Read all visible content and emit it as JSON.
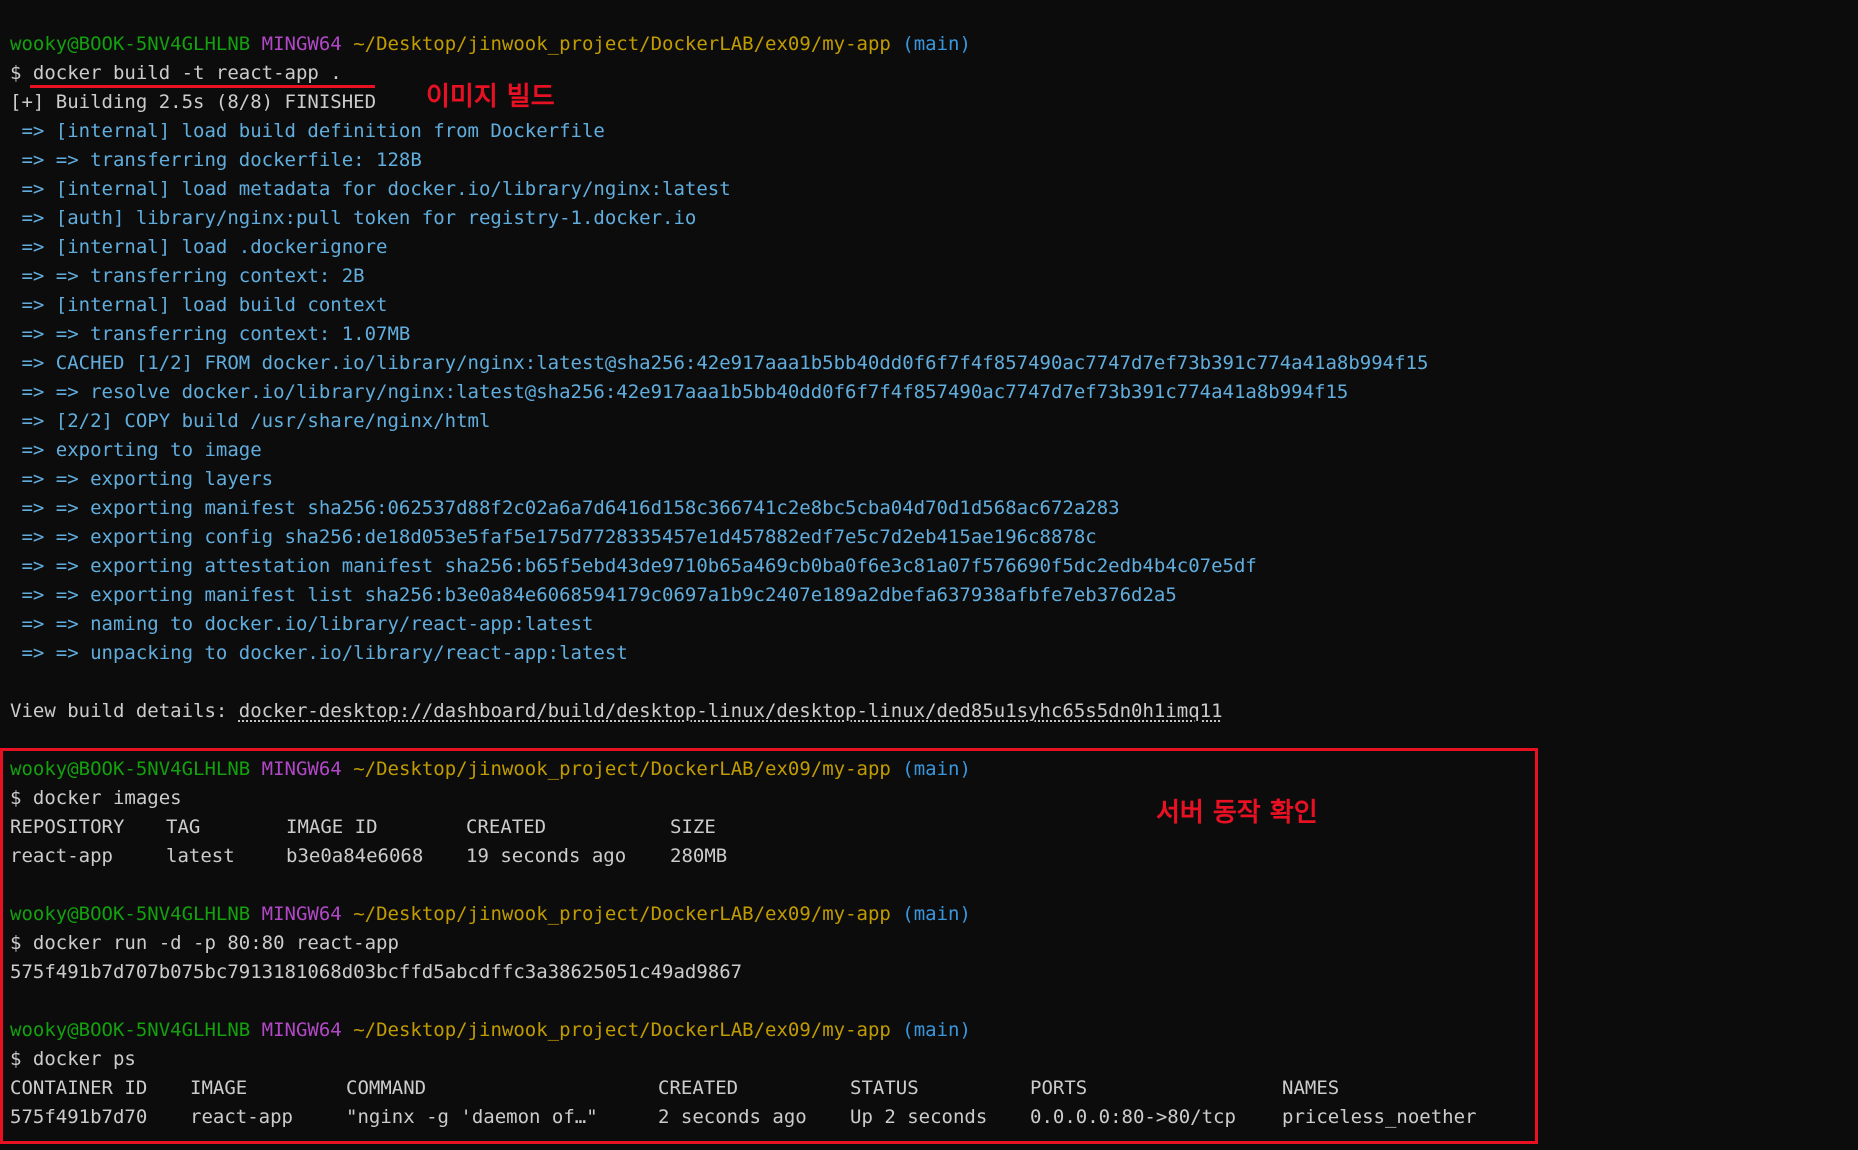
{
  "prompt": {
    "user_host": "wooky@BOOK-5NV4GLHLNB",
    "shell": "MINGW64",
    "path": "~/Desktop/jinwook_project/DockerLAB/ex09/my-app",
    "branch": "(main)"
  },
  "build": {
    "command": "$ docker build -t react-app .",
    "status": "[+] Building 2.5s (8/8) FINISHED",
    "steps": [
      " => [internal] load build definition from Dockerfile",
      " => => transferring dockerfile: 128B",
      " => [internal] load metadata for docker.io/library/nginx:latest",
      " => [auth] library/nginx:pull token for registry-1.docker.io",
      " => [internal] load .dockerignore",
      " => => transferring context: 2B",
      " => [internal] load build context",
      " => => transferring context: 1.07MB",
      " => CACHED [1/2] FROM docker.io/library/nginx:latest@sha256:42e917aaa1b5bb40dd0f6f7f4f857490ac7747d7ef73b391c774a41a8b994f15",
      " => => resolve docker.io/library/nginx:latest@sha256:42e917aaa1b5bb40dd0f6f7f4f857490ac7747d7ef73b391c774a41a8b994f15",
      " => [2/2] COPY build /usr/share/nginx/html",
      " => exporting to image",
      " => => exporting layers",
      " => => exporting manifest sha256:062537d88f2c02a6a7d6416d158c366741c2e8bc5cba04d70d1d568ac672a283",
      " => => exporting config sha256:de18d053e5faf5e175d7728335457e1d457882edf7e5c7d2eb415ae196c8878c",
      " => => exporting attestation manifest sha256:b65f5ebd43de9710b65a469cb0ba0f6e3c81a07f576690f5dc2edb4b4c07e5df",
      " => => exporting manifest list sha256:b3e0a84e6068594179c0697a1b9c2407e189a2dbefa637938afbfe7eb376d2a5",
      " => => naming to docker.io/library/react-app:latest",
      " => => unpacking to docker.io/library/react-app:latest"
    ],
    "details_label": "View build details: ",
    "details_link": "docker-desktop://dashboard/build/desktop-linux/desktop-linux/ded85u1syhc65s5dn0h1imq11",
    "annotation": "이미지 빌드"
  },
  "images_cmd": {
    "command": "$ docker images",
    "headers": [
      "REPOSITORY",
      "TAG",
      "IMAGE ID",
      "CREATED",
      "SIZE"
    ],
    "rows": [
      [
        "react-app",
        "latest",
        "b3e0a84e6068",
        "19 seconds ago",
        "280MB"
      ]
    ],
    "annotation": "서버 동작 확인"
  },
  "run_cmd": {
    "command": "$ docker run -d -p 80:80 react-app",
    "output": "575f491b7d707b075bc7913181068d03bcffd5abcdffc3a38625051c49ad9867"
  },
  "ps_cmd": {
    "command": "$ docker ps",
    "headers": [
      "CONTAINER ID",
      "IMAGE",
      "COMMAND",
      "CREATED",
      "STATUS",
      "PORTS",
      "NAMES"
    ],
    "rows": [
      [
        "575f491b7d70",
        "react-app",
        "\"nginx -g 'daemon of…\"",
        "2 seconds ago",
        "Up 2 seconds",
        "0.0.0.0:80->80/tcp",
        "priceless_noether"
      ]
    ]
  },
  "colors": {
    "background": "#0c0c0c",
    "prompt_user": "#13a10e",
    "prompt_shell": "#b148c6",
    "prompt_path": "#c19c00",
    "prompt_branch": "#3a96dd",
    "build_steps": "#61aede",
    "annotation": "#e81123"
  }
}
